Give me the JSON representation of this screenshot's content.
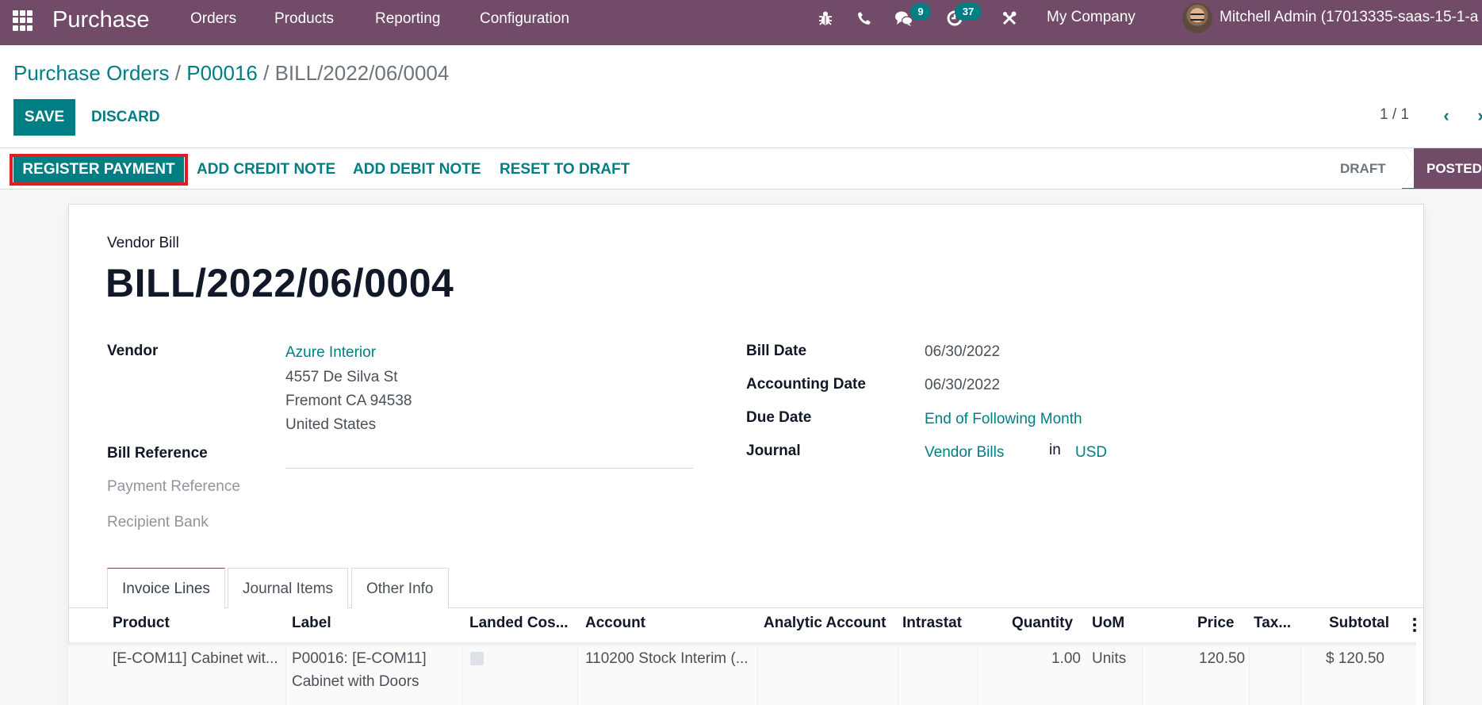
{
  "navbar": {
    "app_name": "Purchase",
    "menu": [
      "Orders",
      "Products",
      "Reporting",
      "Configuration"
    ],
    "icons": [
      "debug-icon",
      "phone-icon",
      "chat-icon",
      "activity-clock-icon",
      "settings-tools-icon"
    ],
    "messages_badge": "9",
    "activities_badge": "37",
    "company": "My Company",
    "user": "Mitchell Admin (17013335-saas-15-1-a"
  },
  "breadcrumb": {
    "items": [
      "Purchase Orders",
      "P00016"
    ],
    "separator": "/",
    "current": "BILL/2022/06/0004"
  },
  "control_panel": {
    "save_label": "SAVE",
    "discard_label": "DISCARD",
    "pager": "1 / 1",
    "prev": "‹",
    "next": "›"
  },
  "statusbar": {
    "buttons": [
      "REGISTER PAYMENT",
      "ADD CREDIT NOTE",
      "ADD DEBIT NOTE",
      "RESET TO DRAFT"
    ],
    "highlighted_button": "REGISTER PAYMENT",
    "stages": [
      "DRAFT",
      "POSTED"
    ],
    "current_stage": "POSTED",
    "colors": {
      "primary": "#017E84",
      "brand": "#714B67",
      "highlight": "#e21c26"
    }
  },
  "form": {
    "doc_type": "Vendor Bill",
    "title": "BILL/2022/06/0004",
    "left": {
      "vendor_label": "Vendor",
      "vendor_name": "Azure Interior",
      "vendor_address": [
        "4557 De Silva St",
        "Fremont CA 94538",
        "United States"
      ],
      "bill_reference_label": "Bill Reference",
      "bill_reference_value": "",
      "payment_reference_label": "Payment Reference",
      "recipient_bank_label": "Recipient Bank"
    },
    "right": {
      "bill_date_label": "Bill Date",
      "bill_date": "06/30/2022",
      "accounting_date_label": "Accounting Date",
      "accounting_date": "06/30/2022",
      "due_date_label": "Due Date",
      "due_date": "End of Following Month",
      "journal_label": "Journal",
      "journal": "Vendor Bills",
      "in_label": "in",
      "currency": "USD"
    }
  },
  "tabs": [
    "Invoice Lines",
    "Journal Items",
    "Other Info"
  ],
  "active_tab": "Invoice Lines",
  "table": {
    "columns": [
      "Product",
      "Label",
      "Landed Cos...",
      "Account",
      "Analytic Account",
      "Intrastat",
      "Quantity",
      "UoM",
      "Price",
      "Tax...",
      "Subtotal"
    ],
    "rows": [
      {
        "product": "[E-COM11] Cabinet wit...",
        "label_line1": "P00016: [E-COM11]",
        "label_line2": "Cabinet with Doors",
        "landed_cost": false,
        "account": "110200 Stock Interim (...",
        "analytic_account": "",
        "intrastat": "",
        "quantity": "1.00",
        "uom": "Units",
        "price": "120.50",
        "taxes": "",
        "subtotal": "$ 120.50"
      }
    ]
  }
}
